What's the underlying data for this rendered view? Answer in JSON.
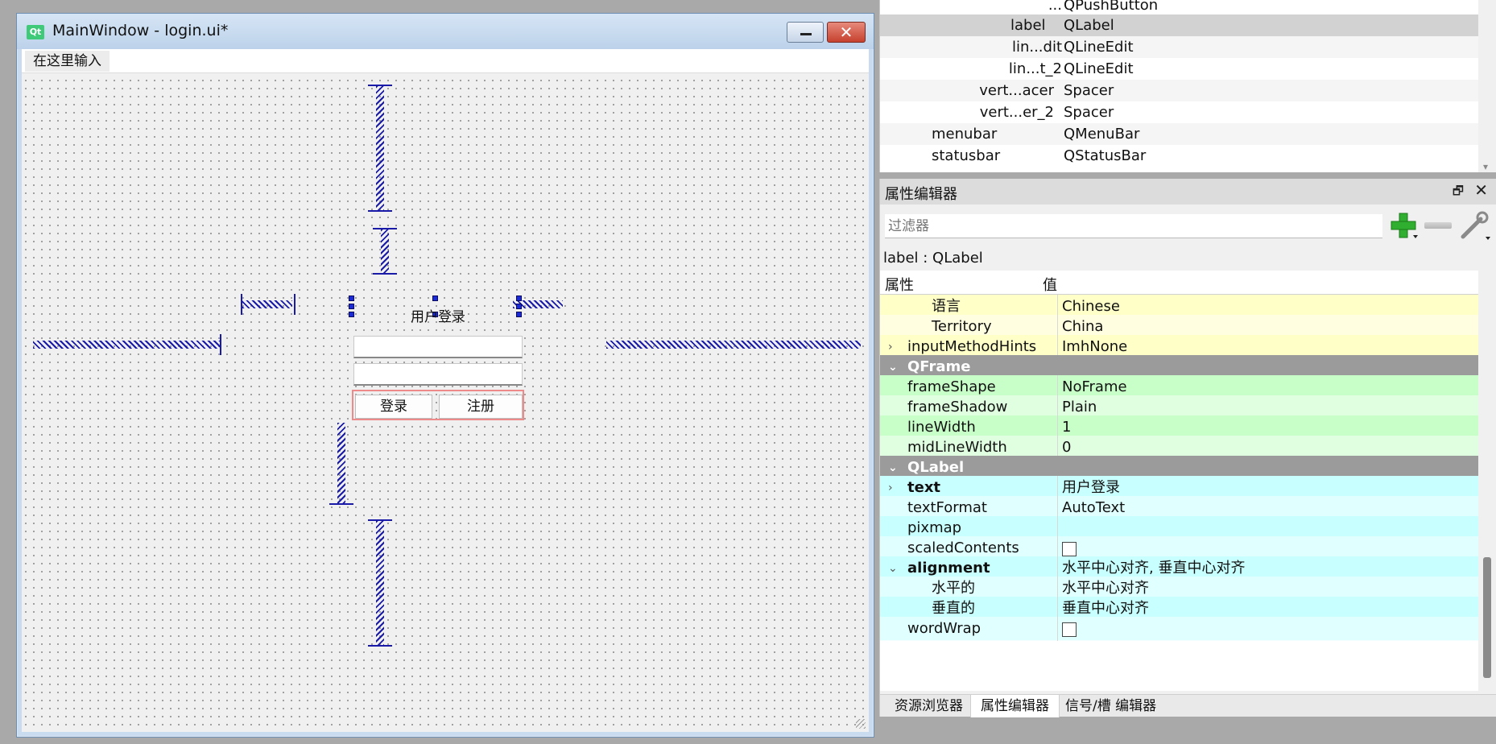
{
  "form_window": {
    "logo": "Qt",
    "title": "MainWindow - login.ui*",
    "menu_placeholder": "在这里输入",
    "login_label": "用户登录",
    "login_button": "登录",
    "register_button": "注册"
  },
  "object_inspector": {
    "rows": [
      {
        "name": "...",
        "class": "QPushButton"
      },
      {
        "name": "label",
        "class": "QLabel",
        "selected": true
      },
      {
        "name": "lin...dit",
        "class": "QLineEdit"
      },
      {
        "name": "lin...t_2",
        "class": "QLineEdit"
      },
      {
        "name": "vert...acer",
        "class": "Spacer"
      },
      {
        "name": "vert...er_2",
        "class": "Spacer"
      },
      {
        "name": "menubar",
        "class": "QMenuBar"
      },
      {
        "name": "statusbar",
        "class": "QStatusBar"
      }
    ]
  },
  "property_editor": {
    "title": "属性编辑器",
    "filter_placeholder": "过滤器",
    "object_label": "label : QLabel",
    "col_property": "属性",
    "col_value": "值",
    "rows": [
      {
        "name": "语言",
        "value": "Chinese"
      },
      {
        "name": "Territory",
        "value": "China"
      },
      {
        "name": "inputMethodHints",
        "value": "ImhNone"
      },
      {
        "name": "QFrame",
        "value": ""
      },
      {
        "name": "frameShape",
        "value": "NoFrame"
      },
      {
        "name": "frameShadow",
        "value": "Plain"
      },
      {
        "name": "lineWidth",
        "value": "1"
      },
      {
        "name": "midLineWidth",
        "value": "0"
      },
      {
        "name": "QLabel",
        "value": ""
      },
      {
        "name": "text",
        "value": "用户登录"
      },
      {
        "name": "textFormat",
        "value": "AutoText"
      },
      {
        "name": "pixmap",
        "value": ""
      },
      {
        "name": "scaledContents",
        "value": ""
      },
      {
        "name": "alignment",
        "value": "水平中心对齐, 垂直中心对齐"
      },
      {
        "name": "水平的",
        "value": "水平中心对齐"
      },
      {
        "name": "垂直的",
        "value": "垂直中心对齐"
      },
      {
        "name": "wordWrap",
        "value": ""
      }
    ],
    "checkboxes": {
      "scaledContents": false,
      "wordWrap": false
    }
  },
  "dock_tabs": [
    {
      "label": "资源浏览器",
      "active": false
    },
    {
      "label": "属性编辑器",
      "active": true
    },
    {
      "label": "信号/槽 编辑器",
      "active": false
    }
  ],
  "colors": {
    "qobject_rows": "#ffffc8",
    "qframe_rows": "#c8ffc8",
    "qlabel_rows": "#c8ffff",
    "section_header": "#9b9b9b",
    "spacer": "#1a1aa8"
  },
  "icons": [
    "qt-logo-icon",
    "minimize-icon",
    "close-icon",
    "float-icon",
    "dock-close-icon",
    "add-icon",
    "remove-icon",
    "wrench-icon",
    "chevron-right-icon",
    "chevron-down-icon"
  ]
}
